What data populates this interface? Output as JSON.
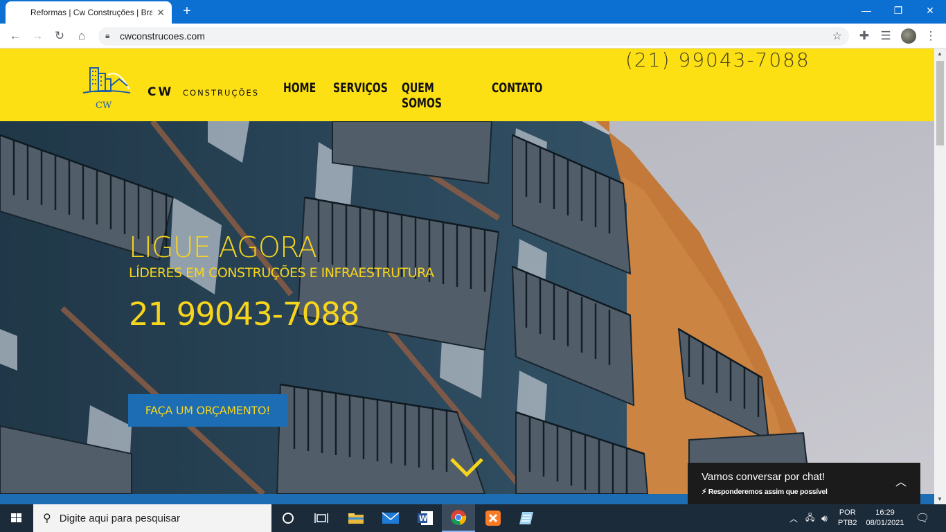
{
  "browser": {
    "tab_title": "Reformas | Cw Construções | Brasil",
    "url": "cwconstrucoes.com"
  },
  "site": {
    "brand": "CW",
    "brand_sub": "CONSTRUÇÕES",
    "logo_text": "CW",
    "nav": [
      "HOME",
      "SERVIÇOS",
      "QUEM SOMOS",
      "CONTATO"
    ],
    "phone_top": "(21) 99043-7088"
  },
  "hero": {
    "title": "LIGUE AGORA",
    "subtitle": "LÍDERES EM CONSTRUÇÕES E INFRAESTRUTURA",
    "phone": "21 99043-7088",
    "cta": "FAÇA UM ORÇAMENTO!"
  },
  "chat": {
    "title": "Vamos conversar por chat!",
    "subtitle": "Responderemos assim que possível"
  },
  "taskbar": {
    "search_placeholder": "Digite aqui para pesquisar",
    "lang1": "POR",
    "lang2": "PTB2",
    "time": "16:29",
    "date": "08/01/2021"
  },
  "colors": {
    "header_yellow": "#fde013",
    "accent_yellow": "#f7d51c",
    "button_blue": "#1d6db4",
    "tab_blue": "#0c6fd2"
  }
}
